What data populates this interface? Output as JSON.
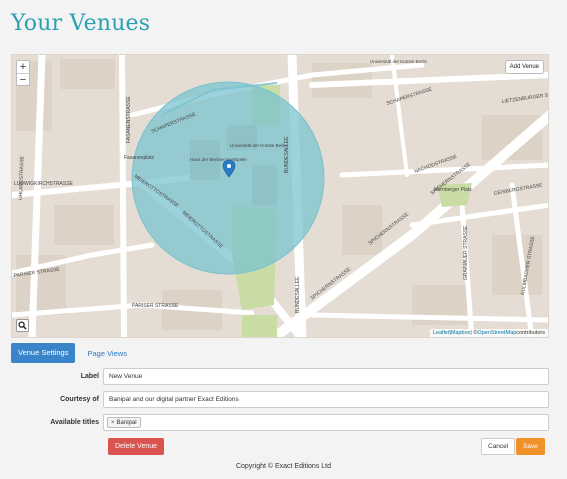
{
  "page": {
    "title": "Your Venues"
  },
  "map": {
    "zoom_in": "+",
    "zoom_out": "−",
    "add_venue_label": "Add Venue",
    "street_labels": {
      "uhlandstrasse": "UHLANDSTRASSE",
      "fasanenstrasse": "FASANENSTRASSE",
      "schaperstrasse_left": "SCHAPERSTRASSE",
      "schaperstrasse_right": "SCHAPERSTRASSE",
      "ludwigkirchstrasse": "LUDWIGKIRCHSTRASSE",
      "meierottostrasse_1": "MEIEROTTOSTRASSE",
      "meierottostrasse_2": "MEIEROTTOSTRASSE",
      "bundesallee_top": "BUNDESALLEE",
      "bundesallee_bottom": "BUNDESALLEE",
      "spichernstrasse_1": "SPICHERNSTRASSE",
      "spichernstrasse_2": "SPICHERNSTRASSE",
      "spichernstrasse_3": "SPICHERNSTRASSE",
      "nachodstrasse": "NACHODSTRASSE",
      "geisbergstrasse": "GEISBERGSTRASSE",
      "luetzenburger": "LIETZENBURGER STRA",
      "pariser_left": "PARISER STRASSE",
      "pariser_right": "PARISER STRASSE",
      "fasanenplatz": "Fasanenplatz",
      "haus_berliner": "Haus der Berliner Festspiele",
      "universitaet": "Universität der Künste Berlin",
      "universitaet_top": "Universität der Künste Berlin",
      "nurnberger_platz": "Nürnberger Platz",
      "grainauer": "GRAINAUER STRASSE",
      "kulmbacher": "KULMBACHER STRASSE"
    },
    "attribution": {
      "leaflet": "Leaflet",
      "sep1": " | ",
      "mapbox": "Mapbox",
      "sep2": " | © ",
      "osm": "OpenStreetMap",
      "contributors": " contributors"
    },
    "colors": {
      "radius_fill": "#79c3cf",
      "marker": "#2b7bc4",
      "park": "#c9dca4"
    }
  },
  "tabs": [
    {
      "label": "Venue Settings",
      "active": true
    },
    {
      "label": "Page Views",
      "active": false
    }
  ],
  "form": {
    "label_field": {
      "label": "Label",
      "value": "New Venue"
    },
    "courtesy_field": {
      "label": "Courtesy of",
      "value": "Banipal and our digital partner Exact Editions"
    },
    "titles_field": {
      "label": "Available titles",
      "tags": [
        {
          "remove": "×",
          "name": "Banipal"
        }
      ]
    }
  },
  "buttons": {
    "delete": "Delete Venue",
    "cancel": "Cancel",
    "save": "Save"
  },
  "footer": {
    "copyright": "Copyright © Exact Editions Ltd"
  }
}
